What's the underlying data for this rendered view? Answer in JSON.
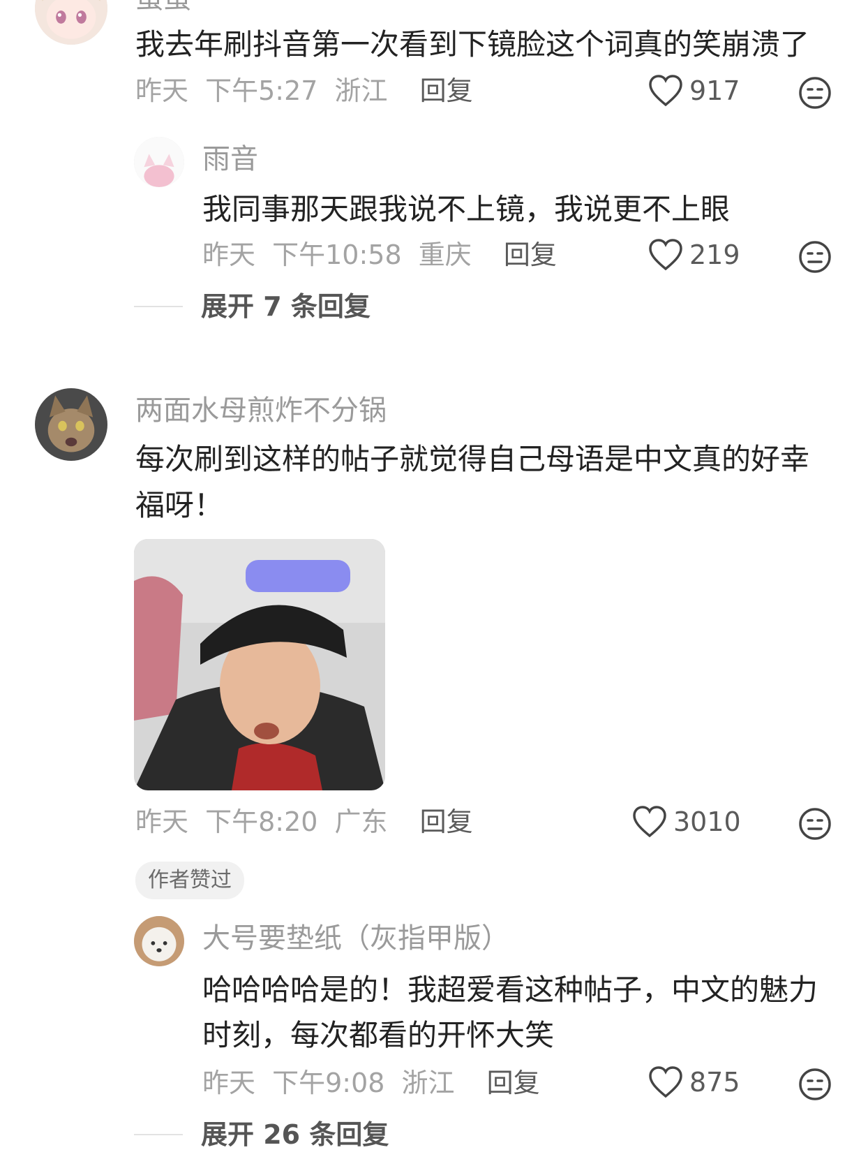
{
  "comments": [
    {
      "name": "蛋蛋",
      "content": "我去年刷抖音第一次看到下镜脸这个词真的笑崩溃了",
      "date": "昨天",
      "time": "下午5:27",
      "location": "浙江",
      "reply_label": "回复",
      "likes": "917",
      "replies": [
        {
          "name": "雨音",
          "content": "我同事那天跟我说不上镜，我说更不上眼",
          "date": "昨天",
          "time": "下午10:58",
          "location": "重庆",
          "reply_label": "回复",
          "likes": "219"
        }
      ],
      "expand_label": "展开 7 条回复"
    },
    {
      "name": "两面水母煎炸不分锅",
      "content_lines": [
        "每次刷到这样的帖子就觉得自己母语是中文真的好幸",
        "福呀！"
      ],
      "date": "昨天",
      "time": "下午8:20",
      "location": "广东",
      "reply_label": "回复",
      "likes": "3010",
      "badge": "作者赞过",
      "replies": [
        {
          "name": "大号要垫纸（灰指甲版）",
          "content_lines": [
            "哈哈哈哈是的！我超爱看这种帖子，中文的魅力",
            "时刻，每次都看的开怀大笑"
          ],
          "date": "昨天",
          "time": "下午9:08",
          "location": "浙江",
          "reply_label": "回复",
          "likes": "875"
        }
      ],
      "expand_label": "展开 26 条回复"
    }
  ],
  "icons": {
    "like": "heart-outline-icon",
    "dislike": "neutral-face-icon"
  }
}
